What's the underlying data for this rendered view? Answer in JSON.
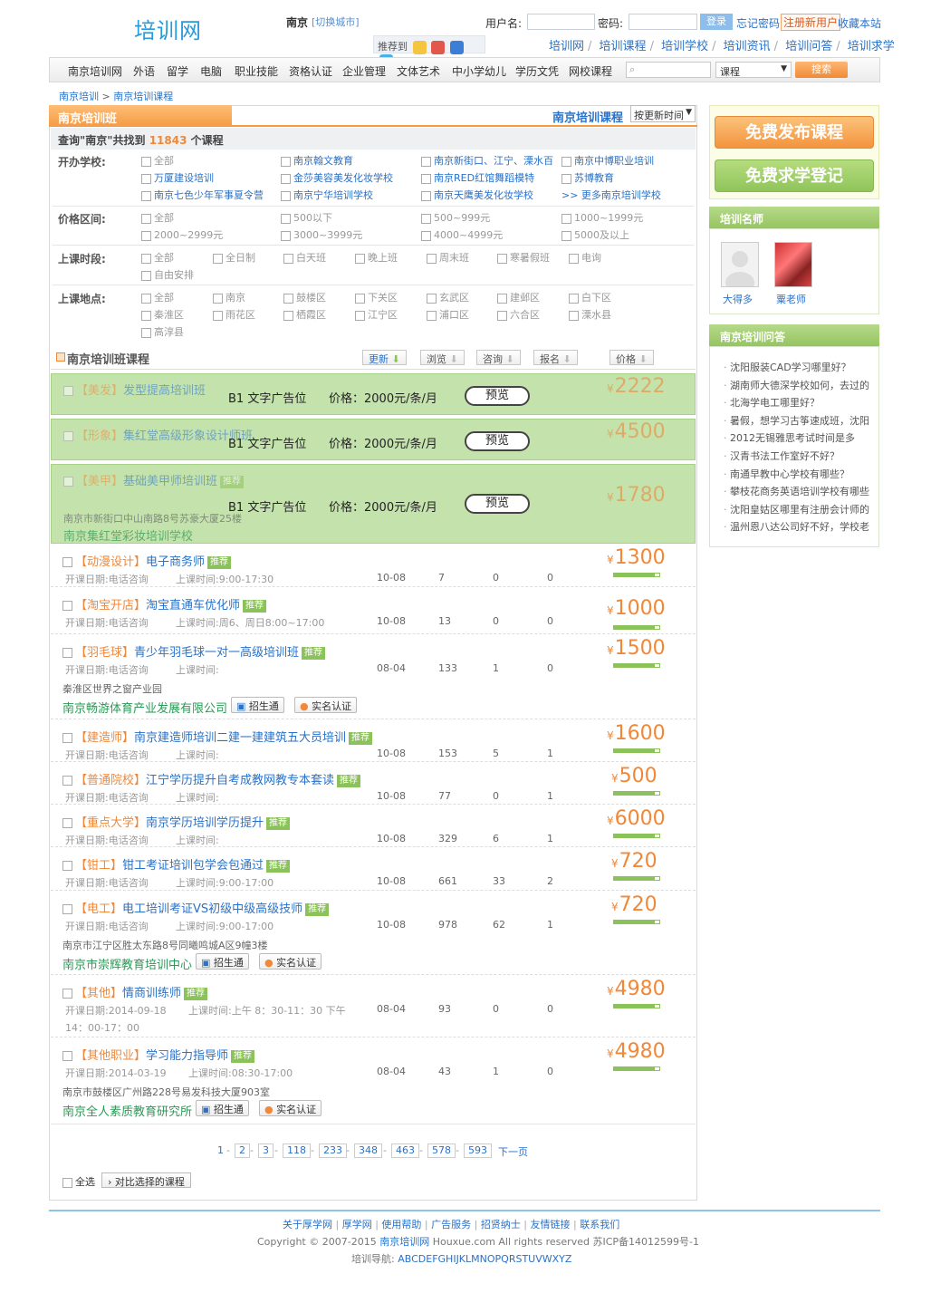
{
  "header": {
    "logo": "培训网",
    "city": "南京",
    "city_switch": "[切换城市]",
    "recommend_label": "推荐到",
    "username_label": "用户名:",
    "password_label": "密码:",
    "login": "登录",
    "forgot": "忘记密码",
    "register": "注册新用户",
    "favorite": "收藏本站",
    "top_nav": [
      "培训网",
      "培训课程",
      "培训学校",
      "培训资讯",
      "培训问答",
      "培训求学"
    ]
  },
  "nav": {
    "items": [
      "南京培训网",
      "外语",
      "留学",
      "电脑",
      "职业技能",
      "资格认证",
      "企业管理",
      "文体艺术",
      "中小学幼儿",
      "学历文凭",
      "网校课程"
    ],
    "search_category": "课程",
    "search_button": "搜索"
  },
  "breadcrumb": {
    "a": "南京培训",
    "sep": " > ",
    "b": "南京培训课程"
  },
  "main": {
    "tab": "南京培训班",
    "title": "南京培训课程",
    "sort_select": "按更新时间",
    "found_prefix": "查询\"南京\"共找到",
    "found_count": "11843",
    "found_suffix": "个课程",
    "filters": {
      "school_label": "开办学校:",
      "schools": [
        "全部",
        "南京翰文教育",
        "南京新街口、江宁、溧水百",
        "南京中博职业培训",
        "万厦建设培训",
        "金莎美容美发化妆学校",
        "南京RED红馆舞蹈模特",
        "苏博教育",
        "南京七色少年军事夏令营",
        "南京宁华培训学校",
        "南京天鹰美发化妆学校",
        ">> 更多南京培训学校"
      ],
      "price_label": "价格区间:",
      "prices": [
        "全部",
        "500以下",
        "500~999元",
        "1000~1999元",
        "2000~2999元",
        "3000~3999元",
        "4000~4999元",
        "5000及以上"
      ],
      "time_label": "上课时段:",
      "times": [
        "全部",
        "全日制",
        "白天班",
        "晚上班",
        "周末班",
        "寒暑假班",
        "电询",
        "自由安排"
      ],
      "place_label": "上课地点:",
      "places": [
        "全部",
        "南京",
        "鼓楼区",
        "下关区",
        "玄武区",
        "建邺区",
        "白下区",
        "秦淮区",
        "雨花区",
        "栖霞区",
        "江宁区",
        "浦口区",
        "六合区",
        "溧水县",
        "高淳县"
      ]
    },
    "list_title": "南京培训班课程",
    "sort_buttons": [
      "更新",
      "浏览",
      "咨询",
      "报名",
      "价格"
    ],
    "ads": [
      {
        "tag": "【美发】",
        "title": "发型提高培训班",
        "text": "B1 文字广告位",
        "price_text": "价格：2000元/条/月",
        "preview": "预览",
        "price": "2222"
      },
      {
        "tag": "【形象】",
        "title": "集红堂高级形象设计师班",
        "text": "B1 文字广告位",
        "price_text": "价格：2000元/条/月",
        "preview": "预览",
        "price": "4500"
      },
      {
        "tag": "【美甲】",
        "title": "基础美甲师培训班",
        "recommend": "推荐",
        "text": "B1 文字广告位",
        "price_text": "价格：2000元/条/月",
        "preview": "预览",
        "price": "1780",
        "address": "南京市新街口中山南路8号苏豪大厦25楼",
        "org": "南京集红堂彩妆培训学校"
      }
    ],
    "meta_labels": {
      "start": "开课日期:",
      "class_time": "上课时间:"
    },
    "courses": [
      {
        "tag": "【动漫设计】",
        "title": "电子商务师",
        "start": "电话咨询",
        "time": "9:00-17:30",
        "date": "10-08",
        "views": "7",
        "consult": "0",
        "enroll": "0",
        "price": "1300"
      },
      {
        "tag": "【淘宝开店】",
        "title": "淘宝直通车优化师",
        "start": "电话咨询",
        "time": "周6、周日8:00~17:00",
        "date": "10-08",
        "views": "13",
        "consult": "0",
        "enroll": "0",
        "price": "1000"
      },
      {
        "tag": "【羽毛球】",
        "title": "青少年羽毛球一对一高级培训班",
        "start": "电话咨询",
        "time": "",
        "date": "08-04",
        "views": "133",
        "consult": "1",
        "enroll": "0",
        "price": "1500",
        "address": "秦淮区世界之窗产业园",
        "org": "南京畅游体育产业发展有限公司"
      },
      {
        "tag": "【建造师】",
        "title": "南京建造师培训二建一建建筑五大员培训",
        "start": "电话咨询",
        "time": "",
        "date": "10-08",
        "views": "153",
        "consult": "5",
        "enroll": "1",
        "price": "1600"
      },
      {
        "tag": "【普通院校】",
        "title": "江宁学历提升自考成教网教专本套读",
        "start": "电话咨询",
        "time": "",
        "date": "10-08",
        "views": "77",
        "consult": "0",
        "enroll": "1",
        "price": "500"
      },
      {
        "tag": "【重点大学】",
        "title": "南京学历培训学历提升",
        "start": "电话咨询",
        "time": "",
        "date": "10-08",
        "views": "329",
        "consult": "6",
        "enroll": "1",
        "price": "6000"
      },
      {
        "tag": "【钳工】",
        "title": "钳工考证培训包学会包通过",
        "start": "电话咨询",
        "time": "9:00-17:00",
        "date": "10-08",
        "views": "661",
        "consult": "33",
        "enroll": "2",
        "price": "720"
      },
      {
        "tag": "【电工】",
        "title": "电工培训考证VS初级中级高级技师",
        "start": "电话咨询",
        "time": "9:00-17:00",
        "date": "10-08",
        "views": "978",
        "consult": "62",
        "enroll": "1",
        "price": "720",
        "address": "南京市江宁区胜太东路8号同曦鸣城A区9幢3楼",
        "org": "南京市崇辉教育培训中心"
      },
      {
        "tag": "【其他】",
        "title": "情商训练师",
        "start": "2014-09-18",
        "time": "上午 8：30-11：30 下午",
        "time2": "14：00-17：00",
        "date": "08-04",
        "views": "93",
        "consult": "0",
        "enroll": "0",
        "price": "4980"
      },
      {
        "tag": "【其他职业】",
        "title": "学习能力指导师",
        "start": "2014-03-19",
        "time": "08:30-17:00",
        "date": "08-04",
        "views": "43",
        "consult": "1",
        "enroll": "0",
        "price": "4980",
        "address": "南京市鼓楼区广州路228号易发科技大厦903室",
        "org": "南京全人素质教育研究所"
      }
    ],
    "recommend": "推荐",
    "badges": {
      "zst": "招生通",
      "real": "实名认证"
    },
    "currency": "¥",
    "pagination": {
      "pages": [
        "1",
        "2",
        "3",
        "118",
        "233",
        "348",
        "463",
        "578",
        "593"
      ],
      "next": "下一页"
    },
    "select_all": "全选",
    "compare": "对比选择的课程"
  },
  "side": {
    "publish": "免费发布课程",
    "register": "免费求学登记",
    "teachers_title": "培训名师",
    "teachers": [
      "大得多",
      "粟老师"
    ],
    "qa_title": "南京培训问答",
    "qa": [
      "沈阳服装CAD学习哪里好？",
      "湖南师大德深学校如何，去过的",
      "北海学电工哪里好？",
      "暑假，想学习古筝速成班，沈阳",
      "2012无锡雅思考试时间是多",
      "汉青书法工作室好不好？",
      "南通早教中心学校有哪些？",
      "攀枝花商务英语培训学校有哪些",
      "沈阳皇姑区哪里有注册会计师的",
      "温州恩八达公司好不好，学校老"
    ]
  },
  "footer": {
    "links": [
      "关于厚学网",
      "厚学网",
      "使用帮助",
      "广告服务",
      "招贤纳士",
      "友情链接",
      "联系我们"
    ],
    "copyright_a": "Copyright © 2007-2015",
    "copyright_b": "南京培训网",
    "copyright_c": "Houxue.com All rights reserved 苏ICP备14012599号-1",
    "alpha_label": "培训导航:",
    "alpha": "ABCDEFGHIJKLMNOPQRSTUVWXYZ"
  },
  "colors": {
    "accent": "#2a72c8",
    "orange": "#f0883a",
    "green": "#8cc25a"
  }
}
